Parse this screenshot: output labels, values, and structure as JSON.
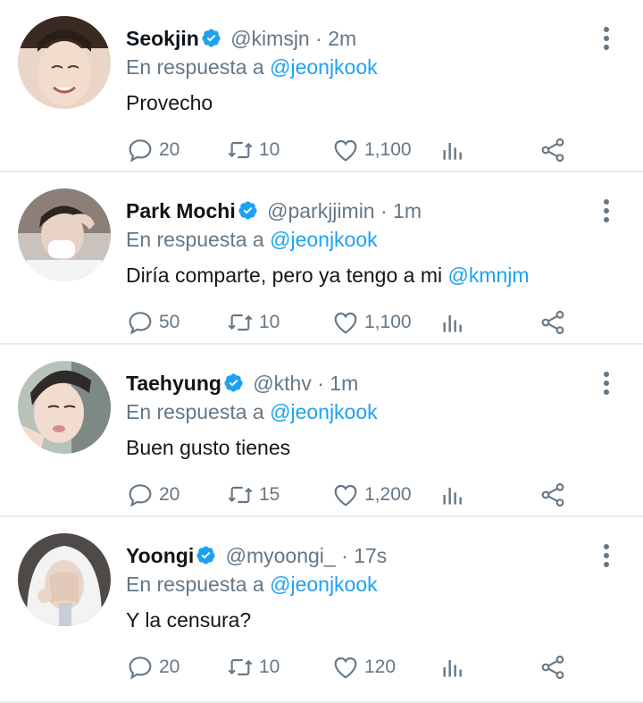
{
  "colors": {
    "accent": "#1da1f2",
    "muted": "#657786",
    "text": "#14171a",
    "divider": "#e6ecf0"
  },
  "icons": {
    "reply": "reply-icon",
    "retweet": "retweet-icon",
    "like": "heart-icon",
    "stats": "analytics-icon",
    "share": "share-icon",
    "verified": "verified-badge-icon",
    "more": "more-options-icon"
  },
  "tweets": [
    {
      "name": "Seokjin",
      "handle": "@kimsjn",
      "dot": "·",
      "time": "2m",
      "reply_prefix": "En respuesta a",
      "reply_to": "@jeonjkook",
      "text": "Provecho",
      "text_mention": "",
      "replies": "20",
      "retweets": "10",
      "likes": "1,100"
    },
    {
      "name": "Park Mochi",
      "handle": "@parkjjimin",
      "dot": "·",
      "time": "1m",
      "reply_prefix": "En respuesta a",
      "reply_to": "@jeonjkook",
      "text": "Diría comparte, pero ya tengo a mi",
      "text_mention": "@kmnjm",
      "replies": "50",
      "retweets": "10",
      "likes": "1,100"
    },
    {
      "name": "Taehyung",
      "handle": "@kthv",
      "dot": "·",
      "time": "1m",
      "reply_prefix": "En respuesta a",
      "reply_to": "@jeonjkook",
      "text": "Buen gusto tienes",
      "text_mention": "",
      "replies": "20",
      "retweets": "15",
      "likes": "1,200"
    },
    {
      "name": "Yoongi",
      "handle": "@myoongi_",
      "dot": "·",
      "time": "17s",
      "reply_prefix": "En respuesta a",
      "reply_to": "@jeonjkook",
      "text": "Y la censura?",
      "text_mention": "",
      "replies": "20",
      "retweets": "10",
      "likes": "120"
    }
  ]
}
